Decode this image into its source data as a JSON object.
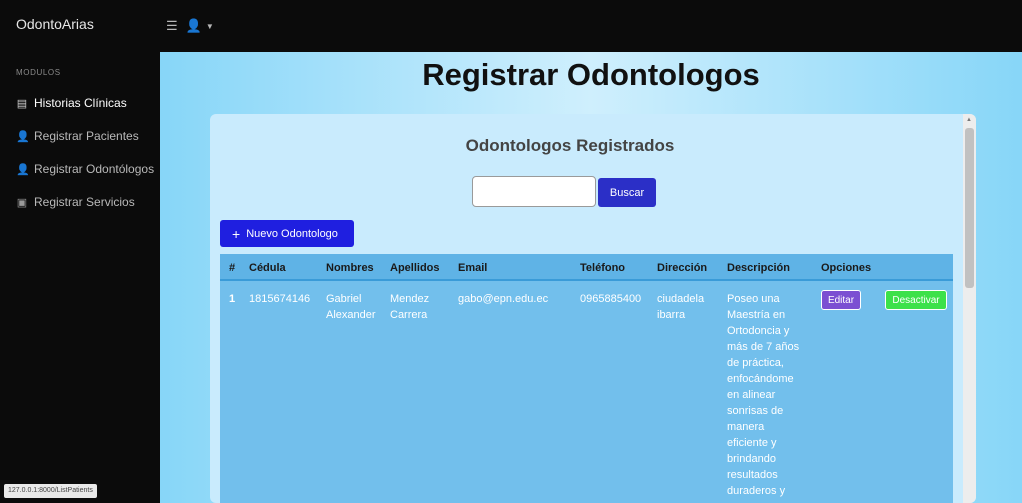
{
  "app": {
    "brand": "OdontoArias"
  },
  "topbar": {
    "menu_icon": "☰",
    "user_icon": "user-icon"
  },
  "sidebar": {
    "section_label": "MODULOS",
    "items": [
      {
        "label": "Historias Clínicas",
        "icon": "document-icon",
        "active": true
      },
      {
        "label": "Registrar Pacientes",
        "icon": "user-plus-icon",
        "active": false
      },
      {
        "label": "Registrar Odontólogos",
        "icon": "user-plus-icon",
        "active": false
      },
      {
        "label": "Registrar Servicios",
        "icon": "calendar-icon",
        "active": false
      }
    ]
  },
  "status_url": "127.0.0.1:8000/ListPatients",
  "main": {
    "page_title": "Registrar Odontologos",
    "card_title": "Odontologos Registrados",
    "search": {
      "value": "",
      "button": "Buscar"
    },
    "new_button": "Nuevo Odontologo",
    "table": {
      "headers": [
        "#",
        "Cédula",
        "Nombres",
        "Apellidos",
        "Email",
        "Teléfono",
        "Dirección",
        "Descripción",
        "Opciones"
      ],
      "rows": [
        {
          "num": "1",
          "cedula": "1815674146",
          "nombres": [
            "Gabriel",
            "Alexander"
          ],
          "apellidos": [
            "Mendez",
            "Carrera"
          ],
          "email": "gabo@epn.edu.ec",
          "telefono": "0965885400",
          "direccion": [
            "ciudadela",
            "ibarra"
          ],
          "descripcion": [
            "Poseo una",
            "Maestría en",
            "Ortodoncia y",
            "más de 7 años",
            "de práctica,",
            "enfocándome",
            "en alinear",
            "sonrisas de",
            "manera",
            "eficiente y",
            "brindando",
            "resultados",
            "duraderos y"
          ],
          "edit": "Editar",
          "deactivate": "Desactivar"
        }
      ]
    }
  },
  "colors": {
    "sidebar": "#0b0b0b",
    "main_gradient_edge": "#87d6f8",
    "card": "#c9ebfd",
    "table": "#72bfec",
    "buscar": "#2b2fc7",
    "nuevo": "#1f1fe0",
    "editar": "#7b4fd2",
    "desactivar": "#3ce14a"
  }
}
